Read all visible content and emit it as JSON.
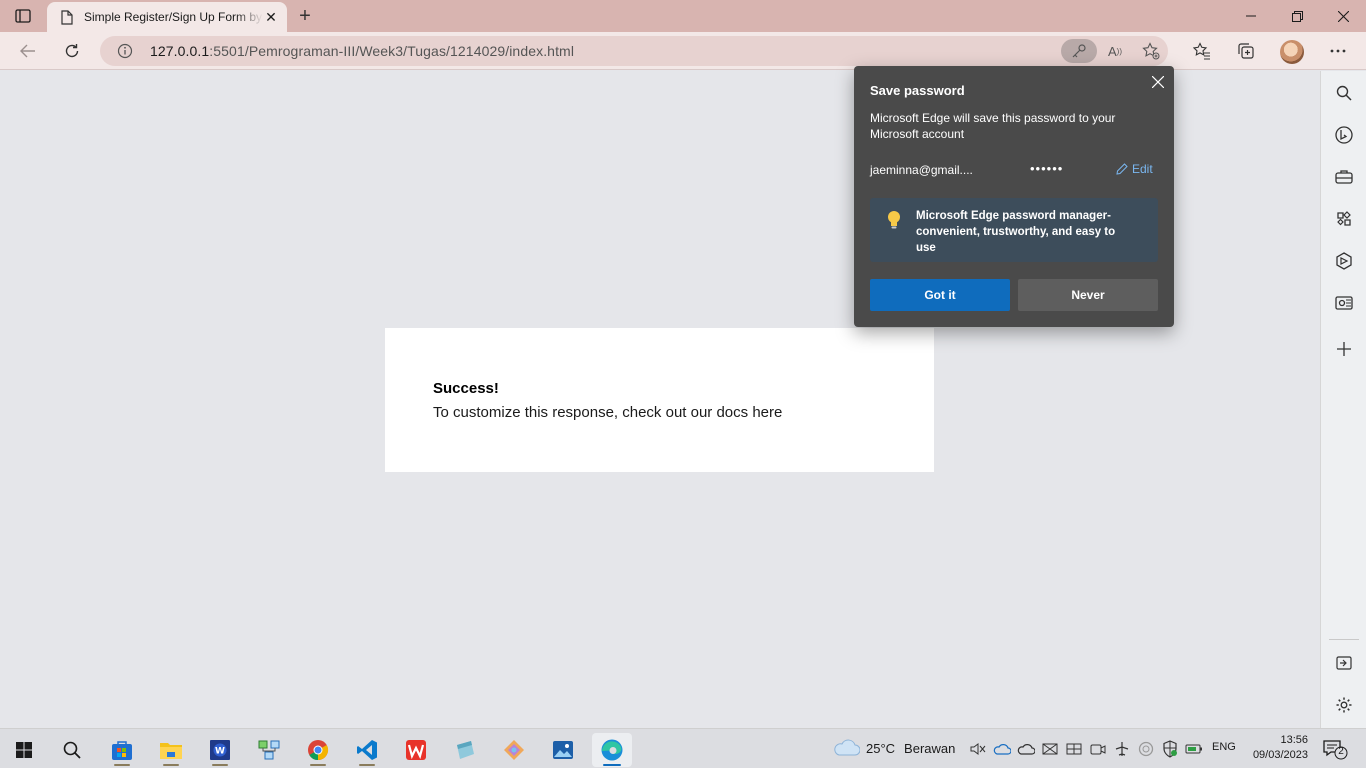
{
  "browser": {
    "tab_title": "Simple Register/Sign Up Form by",
    "url_host": "127.0.0.1",
    "url_path": ":5501/Pemrograman-III/Week3/Tugas/1214029/index.html"
  },
  "page": {
    "success_title": "Success!",
    "success_body": "To customize this response, check out our docs here"
  },
  "password_popup": {
    "title": "Save password",
    "description": "Microsoft Edge will save this password to your Microsoft account",
    "username": "jaeminna@gmail....",
    "password_mask": "••••••",
    "edit_label": "Edit",
    "tip": "Microsoft Edge password manager- convenient, trustworthy, and easy to use",
    "got_it_label": "Got it",
    "never_label": "Never"
  },
  "taskbar": {
    "temperature": "25°C",
    "weather": "Berawan",
    "language": "ENG",
    "time": "13:56",
    "date": "09/03/2023",
    "notification_count": "2"
  },
  "colors": {
    "titlebar": "#d8b4b0",
    "toolbar": "#f3e8e7",
    "popup_bg": "#4a4a4a",
    "primary_button": "#0f6cbd"
  }
}
